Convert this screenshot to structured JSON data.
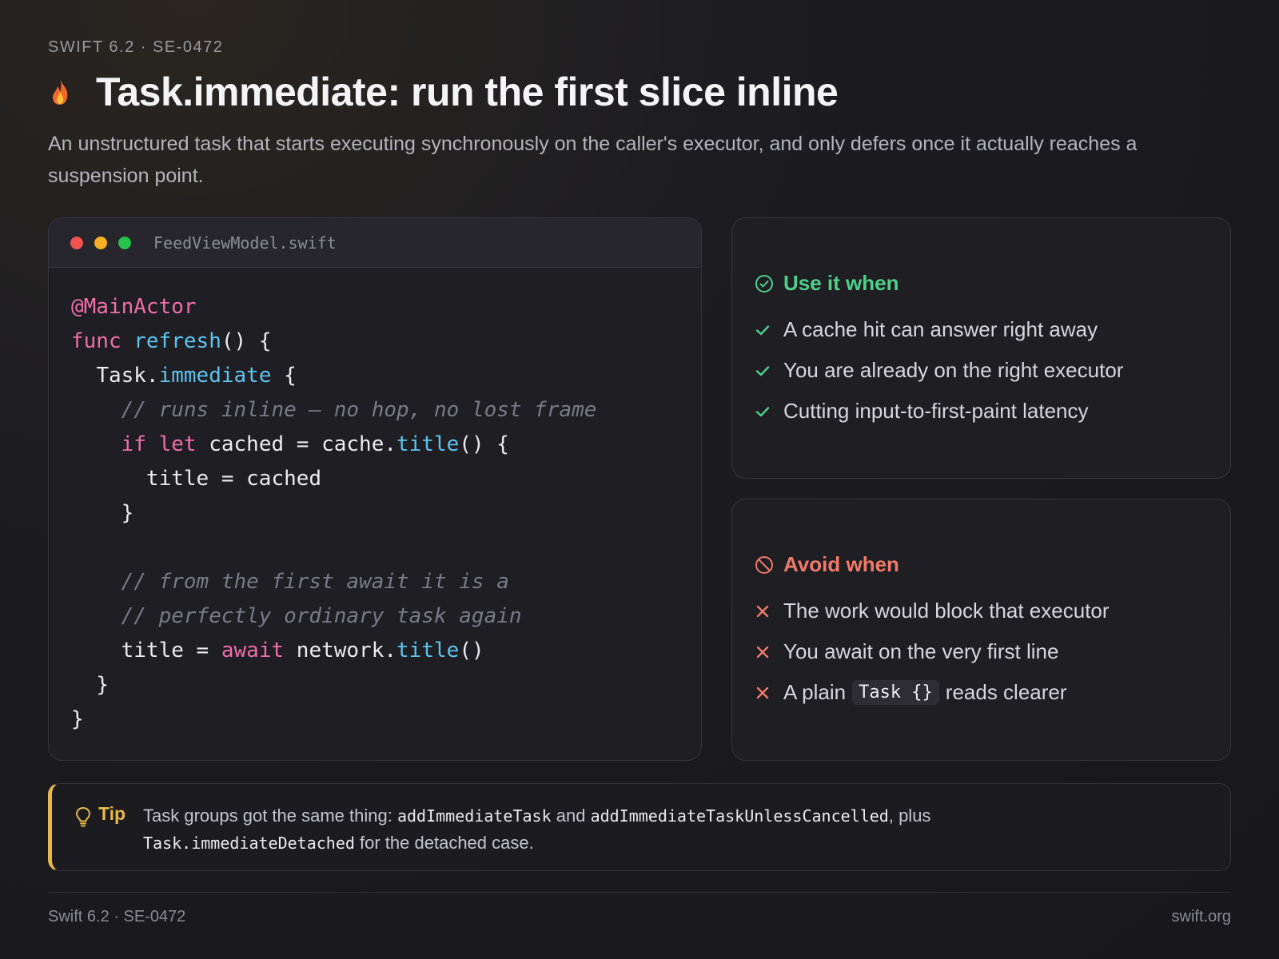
{
  "eyebrow": "SWIFT 6.2 · SE-0472",
  "title": "Task.immediate: run the first slice inline",
  "subtitle": "An unstructured task that starts executing synchronously on the caller's executor, and only defers once it actually reaches a suspension point.",
  "code_panel": {
    "filename": "FeedViewModel.swift",
    "lines": [
      {
        "indent": 0,
        "tokens": [
          {
            "t": "@MainActor",
            "c": "attr"
          }
        ]
      },
      {
        "indent": 0,
        "tokens": [
          {
            "t": "func",
            "c": "kw"
          },
          {
            "t": " "
          },
          {
            "t": "refresh",
            "c": "fn"
          },
          {
            "t": "() {"
          }
        ]
      },
      {
        "indent": 1,
        "tokens": [
          {
            "t": "Task."
          },
          {
            "t": "immediate",
            "c": "fn"
          },
          {
            "t": " {"
          }
        ]
      },
      {
        "indent": 2,
        "tokens": [
          {
            "t": "// runs inline — no hop, no lost frame",
            "c": "cm"
          }
        ]
      },
      {
        "indent": 2,
        "tokens": [
          {
            "t": "if",
            "c": "kw"
          },
          {
            "t": " "
          },
          {
            "t": "let",
            "c": "kw"
          },
          {
            "t": " cached = cache."
          },
          {
            "t": "title",
            "c": "fn"
          },
          {
            "t": "() {"
          }
        ]
      },
      {
        "indent": 3,
        "tokens": [
          {
            "t": "title = cached"
          }
        ]
      },
      {
        "indent": 2,
        "tokens": [
          {
            "t": "}"
          }
        ]
      },
      {
        "indent": 0,
        "tokens": []
      },
      {
        "indent": 2,
        "tokens": [
          {
            "t": "// from the first await it is a",
            "c": "cm"
          }
        ]
      },
      {
        "indent": 2,
        "tokens": [
          {
            "t": "// perfectly ordinary task again",
            "c": "cm"
          }
        ]
      },
      {
        "indent": 2,
        "tokens": [
          {
            "t": "title = "
          },
          {
            "t": "await",
            "c": "kw"
          },
          {
            "t": " network."
          },
          {
            "t": "title",
            "c": "fn"
          },
          {
            "t": "()"
          }
        ]
      },
      {
        "indent": 1,
        "tokens": [
          {
            "t": "}"
          }
        ]
      },
      {
        "indent": 0,
        "tokens": [
          {
            "t": "}"
          }
        ]
      }
    ]
  },
  "use_card": {
    "heading": "Use it when",
    "items": [
      "A cache hit can answer right away",
      "You are already on the right executor",
      "Cutting input-to-first-paint latency"
    ]
  },
  "avoid_card": {
    "heading": "Avoid when",
    "items": [
      "The work would block that executor",
      "You await on the very first line"
    ],
    "last_item": {
      "before": "A plain",
      "code": "Task {}",
      "after": "reads clearer"
    }
  },
  "tip": {
    "label": "Tip",
    "text_1": "Task groups got the same thing: ",
    "code_1": "addImmediateTask",
    "text_2": " and ",
    "code_2": "addImmediateTaskUnlessCancelled",
    "text_3": ", plus",
    "code_3": "Task.immediateDetached",
    "text_4": " for the detached case."
  },
  "footer": {
    "left": "Swift 6.2 · SE-0472",
    "right": "swift.org"
  },
  "colors": {
    "keyword": "#f06eaa",
    "function": "#5ec4f0",
    "comment": "#7a7a84",
    "success": "#4fd08a",
    "danger": "#f07a6a",
    "tip_accent": "#e8b84a"
  },
  "icons": {
    "title": "flame-icon",
    "use_heading": "check-circle-icon",
    "use_item": "check-icon",
    "avoid_heading": "prohibited-icon",
    "avoid_item": "x-icon",
    "tip": "lightbulb-icon"
  }
}
